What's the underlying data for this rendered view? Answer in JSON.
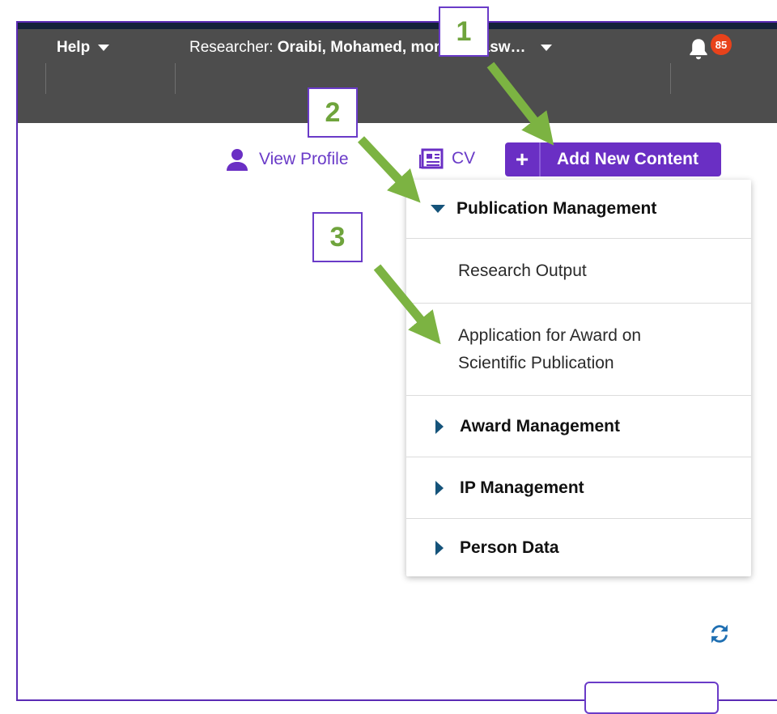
{
  "topbar": {
    "help_label": "Help",
    "researcher_prefix": "Researcher:",
    "researcher_name": "Oraibi, Mohamed, moraibi@asw…",
    "notification_count": "85"
  },
  "profile_links": {
    "view_profile_label": "View Profile",
    "cv_label": "CV"
  },
  "add_button": {
    "plus": "+",
    "label": "Add New Content"
  },
  "menu": {
    "sections": [
      {
        "label": "Publication Management",
        "expanded": true,
        "items": [
          {
            "label": "Research Output"
          },
          {
            "label": "Application for Award on Scientific Publication"
          }
        ]
      },
      {
        "label": "Award Management",
        "expanded": false
      },
      {
        "label": "IP Management",
        "expanded": false
      },
      {
        "label": "Person Data",
        "expanded": false
      }
    ]
  },
  "callouts": [
    "1",
    "2",
    "3"
  ],
  "colors": {
    "accent": "#6a2fc4",
    "topbar": "#4d4d4d",
    "arrow": "#7cb342",
    "badge": "#e8421b",
    "section_triangle": "#15537a"
  },
  "icons": [
    "help-caret-icon",
    "researcher-caret-icon",
    "bell-icon",
    "person-icon",
    "cv-icon",
    "plus-icon",
    "triangle-down-icon",
    "triangle-right-icon",
    "refresh-icon"
  ]
}
